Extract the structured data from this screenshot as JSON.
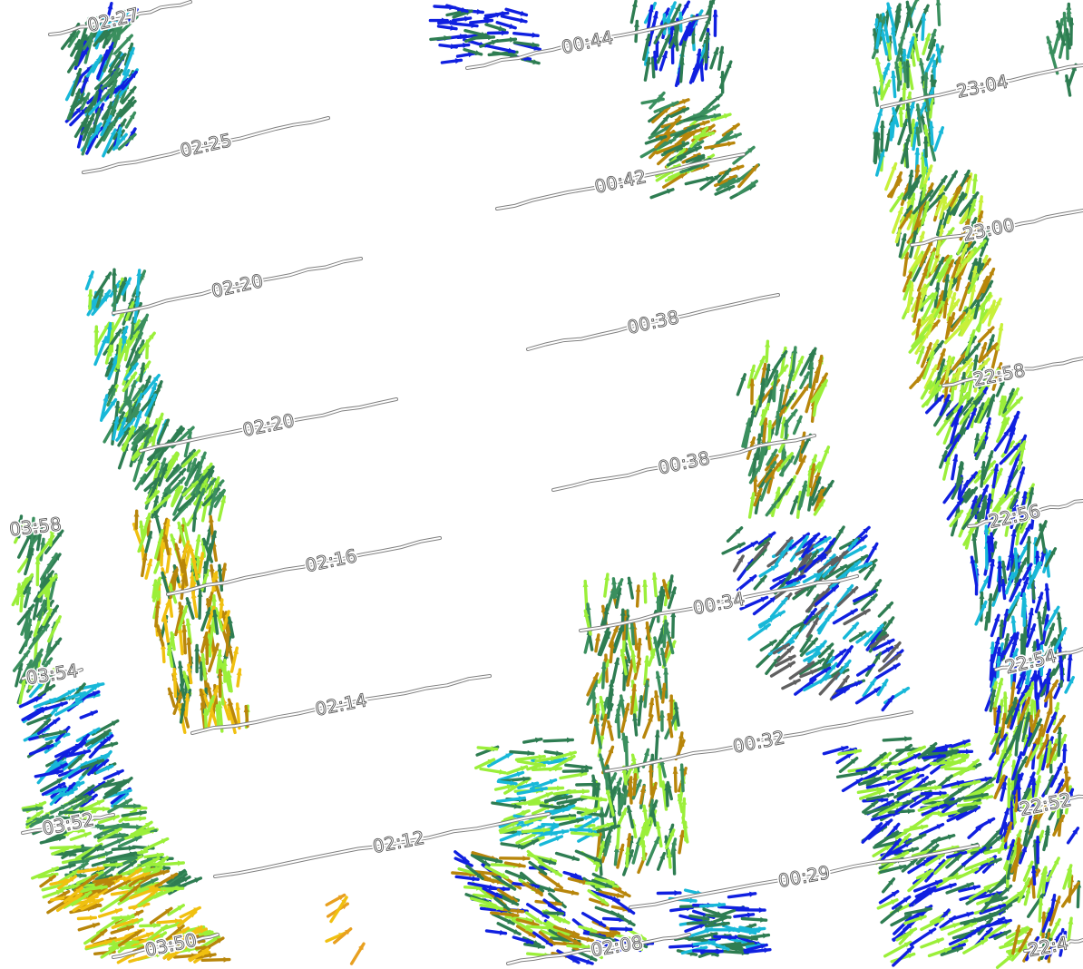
{
  "map": {
    "colors": {
      "dark_green": "#2e7d52",
      "green": "#3a8f5e",
      "light_green": "#9bef3a",
      "yellow_green": "#c8f03a",
      "brown": "#b8860b",
      "gold": "#f0c010",
      "orange": "#e8a020",
      "cyan": "#18b8d8",
      "blue": "#1020e0",
      "gray": "#606060",
      "track": "#808080"
    },
    "time_labels": [
      "02:27",
      "02:25",
      "02:20",
      "02:20",
      "02:16",
      "02:14",
      "02:12",
      "02:08",
      "00:44",
      "00:42",
      "00:38",
      "00:38",
      "00:34",
      "00:32",
      "00:29",
      "23:04",
      "23:00",
      "22:58",
      "22:56",
      "22:54",
      "22:52",
      "22:4",
      "03:58",
      "03:54",
      "03:52",
      "03:50"
    ],
    "icons": {
      "vector_arrow": "wind-vector-arrow-icon"
    }
  }
}
